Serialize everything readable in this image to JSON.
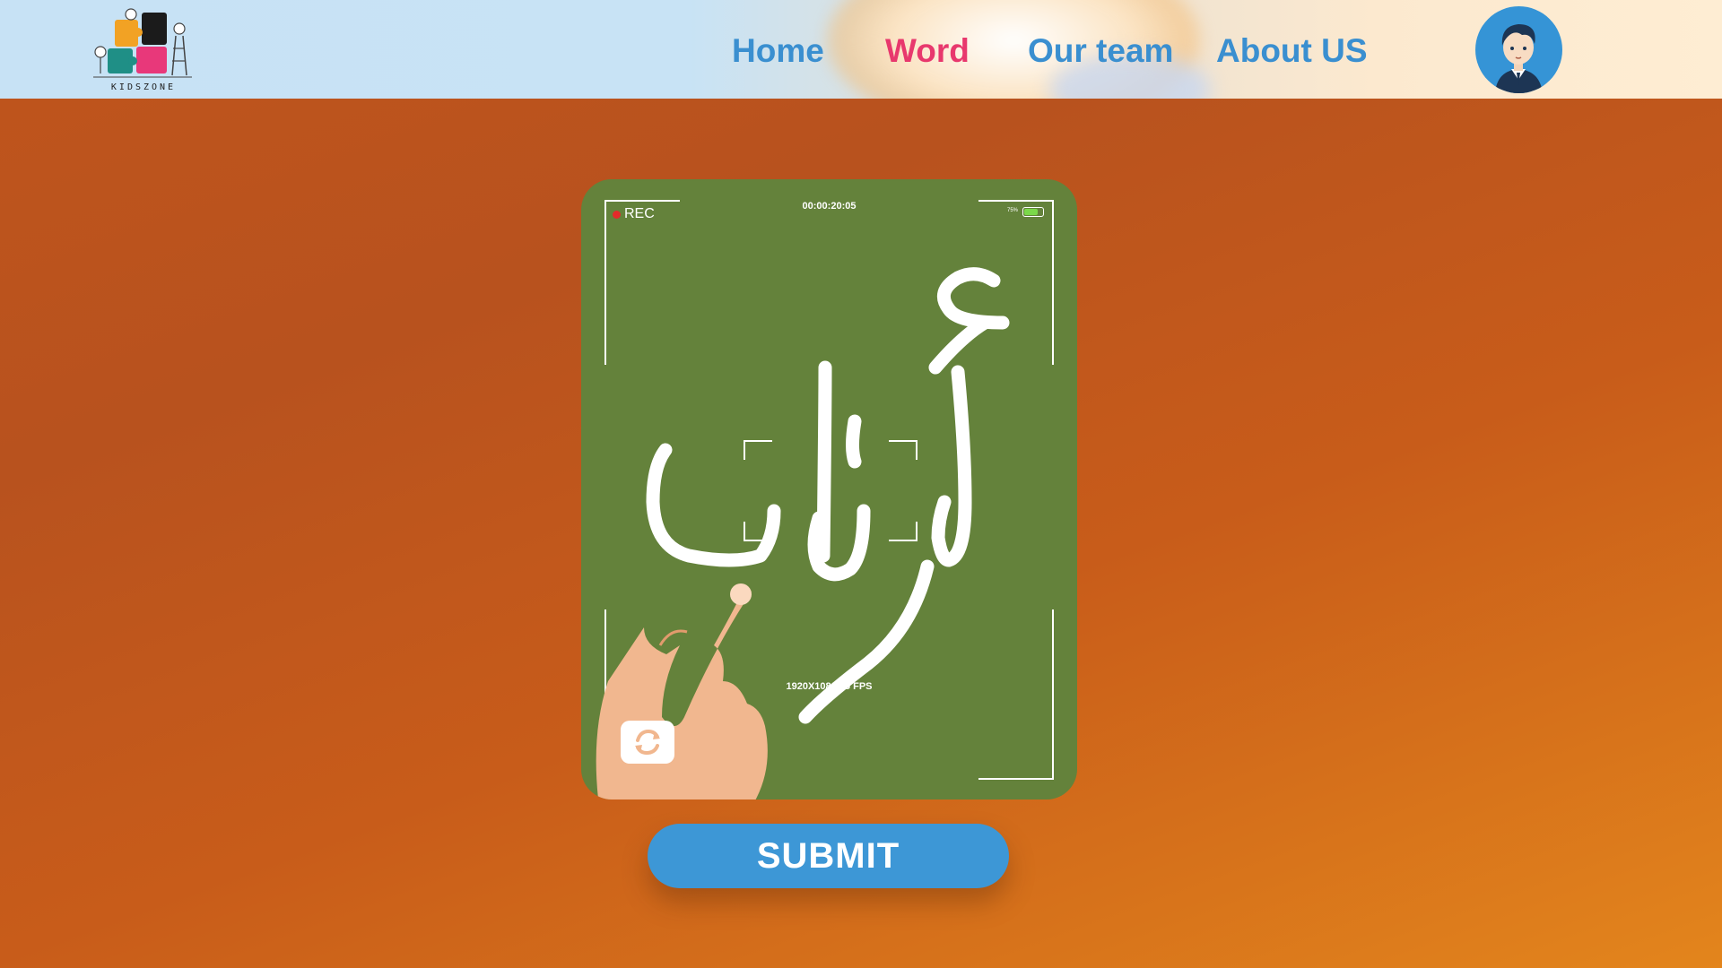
{
  "app": {
    "logo": {
      "text": "KIDSZONE",
      "icon": "kidszone-puzzle-logo"
    }
  },
  "nav": {
    "items": [
      {
        "label": "Home",
        "active": false
      },
      {
        "label": "Word",
        "active": true
      },
      {
        "label": "Our team",
        "active": false
      },
      {
        "label": "About US",
        "active": false
      }
    ],
    "active_color": "#e8386d",
    "color": "#3a8fd0"
  },
  "user": {
    "avatar_icon": "boy-avatar-icon"
  },
  "camera": {
    "rec_label": "REC",
    "timecode": "00:00:20:05",
    "battery_percent_label": "75%",
    "battery_level": 0.75,
    "resolution_label": "1920X1080 25 FPS",
    "word": "أرناب",
    "background_color": "#64823b",
    "refresh_icon": "camera-switch-icon",
    "pointer_icon": "pointing-hand-icon"
  },
  "submit": {
    "label": "SUBMIT",
    "color": "#3d97d6"
  }
}
